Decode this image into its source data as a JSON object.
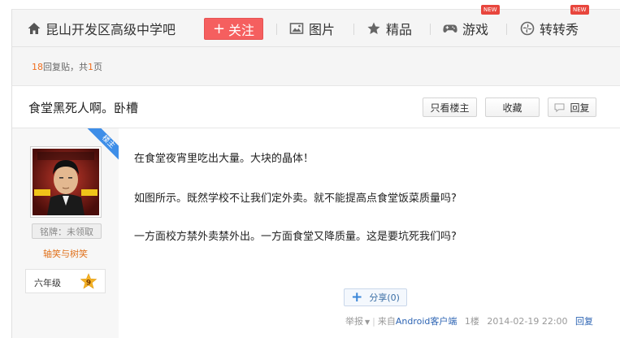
{
  "nav": {
    "forum_name": "昆山开发区高级中学吧",
    "follow_label": "关注",
    "items": [
      {
        "label": "图片",
        "icon": "image-icon",
        "badge": ""
      },
      {
        "label": "精品",
        "icon": "star-icon",
        "badge": ""
      },
      {
        "label": "游戏",
        "icon": "gamepad-icon",
        "badge": "NEW"
      },
      {
        "label": "转转秀",
        "icon": "pinwheel-icon",
        "badge": "NEW"
      }
    ]
  },
  "summary": {
    "reply_count": "18",
    "reply_text": "回复贴，共",
    "page_count": "1",
    "page_text": "页"
  },
  "thread": {
    "title": "食堂黑死人啊。卧槽",
    "only_op_label": "只看楼主",
    "favorite_label": "收藏",
    "reply_label": "回复"
  },
  "post": {
    "op_ribbon": "楼主",
    "author": {
      "medal": "铭牌：未领取",
      "username": "轴笑与树笑",
      "level_name": "六年级",
      "level_num": "9"
    },
    "lines": [
      "在食堂夜宵里吃出大量。大块的晶体！",
      "如图所示。既然学校不让我们定外卖。就不能提高点食堂饭菜质量吗?",
      "一方面校方禁外卖禁外出。一方面食堂又降质量。这是要坑死我们吗?"
    ],
    "share_label": "分享",
    "share_count": "(0)",
    "meta": {
      "report": "举报",
      "source_prefix": "来自",
      "source_link": "Android客户端",
      "floor": "1楼",
      "time": "2014-02-19 22:00",
      "reply": "回复"
    }
  },
  "colors": {
    "follow_bg": "#f55f5f",
    "accent_orange": "#f06e1e",
    "link_blue": "#2d64b3",
    "ribbon_blue": "#3e8ee8"
  }
}
